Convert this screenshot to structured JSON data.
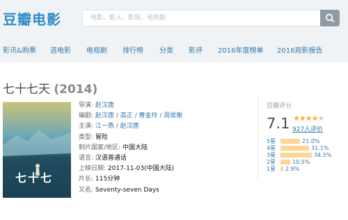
{
  "header": {
    "logo": "豆瓣电影",
    "search_placeholder": "电影、影人、影院、电视剧"
  },
  "nav": [
    {
      "label": "影讯&购票"
    },
    {
      "label": "选电影"
    },
    {
      "label": "电视剧"
    },
    {
      "label": "排行榜"
    },
    {
      "label": "分类"
    },
    {
      "label": "影评"
    },
    {
      "label": "2016年度榜单"
    },
    {
      "label": "2016观影报告"
    }
  ],
  "movie": {
    "title": "七十七天",
    "year": "(2014)",
    "poster_title": "七十七"
  },
  "info": {
    "director_label": "导演:",
    "director": "赵汉唐",
    "writer_label": "编剧:",
    "writers": [
      "赵汉唐",
      "高正",
      "曹金玲",
      "周侯衡"
    ],
    "cast_label": "主演:",
    "cast": [
      "江一燕",
      "赵汉唐"
    ],
    "genre_label": "类型:",
    "genre": "冒险",
    "country_label": "制片国家/地区:",
    "country": "中国大陆",
    "language_label": "语言:",
    "language": "汉语普通话",
    "release_label": "上映日期:",
    "release": "2017-11-03(中国大陆)",
    "runtime_label": "片长:",
    "runtime": "115分钟",
    "aka_label": "又名:",
    "aka": "Seventy-seven Days"
  },
  "rating": {
    "label": "豆瓣评分",
    "score": "7.1",
    "stars": 3.5,
    "count": "927人评价",
    "bars": [
      {
        "label": "5星",
        "pct": "21.0%",
        "value": 21.0
      },
      {
        "label": "4星",
        "pct": "31.1%",
        "value": 31.1
      },
      {
        "label": "3星",
        "pct": "34.5%",
        "value": 34.5
      },
      {
        "label": "2星",
        "pct": "10.5%",
        "value": 10.5
      },
      {
        "label": "1星",
        "pct": "2.9%",
        "value": 2.9
      }
    ]
  },
  "colors": {
    "brand": "#2d8bc8",
    "link": "#3377aa",
    "star": "#ffac2d",
    "bar": "#ffd596"
  }
}
